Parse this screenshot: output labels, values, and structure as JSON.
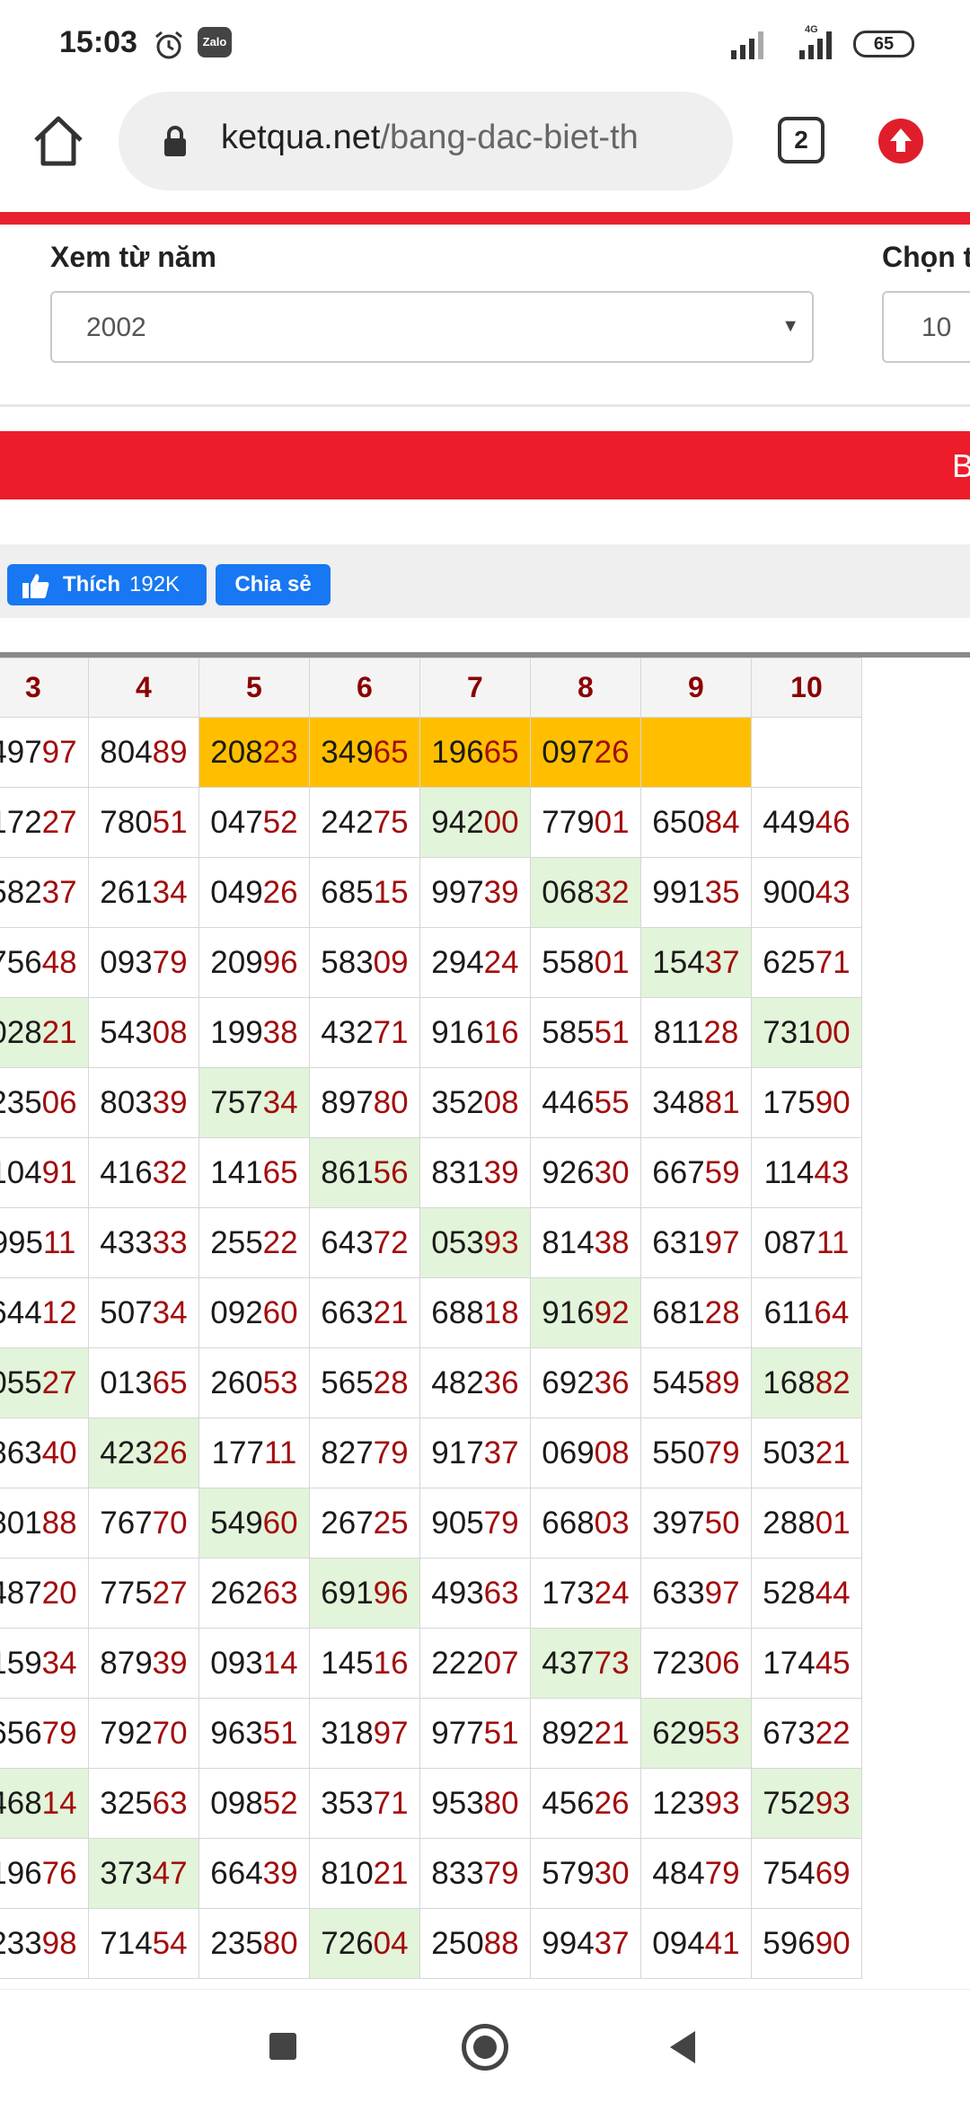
{
  "status_bar": {
    "time": "15:03",
    "zalo": "Zalo",
    "network": "4G",
    "battery": "65"
  },
  "browser": {
    "url_domain": "ketqua.net",
    "url_path": "/bang-dac-biet-th",
    "tab_count": "2"
  },
  "filters": {
    "from_year_label": "Xem từ năm",
    "from_year_value": "2002",
    "choose_label": "Chọn t",
    "choose_value": "10"
  },
  "banner_text": "B",
  "social": {
    "like_label": "Thích",
    "like_count": "192K",
    "share_label": "Chia sẻ"
  },
  "table": {
    "columns": [
      "",
      "3",
      "4",
      "5",
      "6",
      "7",
      "8",
      "9",
      "10"
    ],
    "rows": [
      [
        "",
        "49797",
        "80489",
        "20823",
        "34965",
        "19665",
        "09726",
        "",
        ""
      ],
      [
        "",
        "17227",
        "78051",
        "04752",
        "24275",
        "94200",
        "77901",
        "65084",
        "44946"
      ],
      [
        "",
        "58237",
        "26134",
        "04926",
        "68515",
        "99739",
        "06832",
        "99135",
        "90043"
      ],
      [
        "",
        "75648",
        "09379",
        "20996",
        "58309",
        "29424",
        "55801",
        "15437",
        "62571"
      ],
      [
        "",
        "02821",
        "54308",
        "19938",
        "43271",
        "91616",
        "58551",
        "81128",
        "73100"
      ],
      [
        "",
        "23506",
        "80339",
        "75734",
        "89780",
        "35208",
        "44655",
        "34881",
        "17590"
      ],
      [
        "",
        "10491",
        "41632",
        "14165",
        "86156",
        "83139",
        "92630",
        "66759",
        "11443"
      ],
      [
        "",
        "99511",
        "43333",
        "25522",
        "64372",
        "05393",
        "81438",
        "63197",
        "08711"
      ],
      [
        "",
        "64412",
        "50734",
        "09260",
        "66321",
        "68818",
        "91692",
        "68128",
        "61164"
      ],
      [
        "",
        "05527",
        "01365",
        "26053",
        "56528",
        "48236",
        "69236",
        "54589",
        "16882"
      ],
      [
        "",
        "86340",
        "42326",
        "17711",
        "82779",
        "91737",
        "06908",
        "55079",
        "50321"
      ],
      [
        "",
        "80188",
        "76770",
        "54960",
        "26725",
        "90579",
        "66803",
        "39750",
        "28801"
      ],
      [
        "",
        "48720",
        "77527",
        "26263",
        "69196",
        "49363",
        "17324",
        "63397",
        "52844"
      ],
      [
        "",
        "15934",
        "87939",
        "09314",
        "14516",
        "22207",
        "43773",
        "72306",
        "17445"
      ],
      [
        "",
        "65679",
        "79270",
        "96351",
        "31897",
        "97751",
        "89221",
        "62953",
        "67322"
      ],
      [
        "",
        "46814",
        "32563",
        "09852",
        "35371",
        "95380",
        "45626",
        "12393",
        "75293"
      ],
      [
        "",
        "19676",
        "37347",
        "66439",
        "81021",
        "83379",
        "57930",
        "48479",
        "75469"
      ],
      [
        "",
        "23398",
        "71454",
        "23580",
        "72604",
        "25088",
        "99437",
        "09441",
        "59690"
      ]
    ],
    "highlights": {
      "orange": [
        [
          0,
          2
        ],
        [
          0,
          3
        ],
        [
          0,
          4
        ],
        [
          0,
          5
        ],
        [
          0,
          6
        ]
      ],
      "green": [
        [
          1,
          4
        ],
        [
          2,
          5
        ],
        [
          3,
          6
        ],
        [
          4,
          0
        ],
        [
          4,
          7
        ],
        [
          5,
          2
        ],
        [
          6,
          3
        ],
        [
          7,
          4
        ],
        [
          8,
          5
        ],
        [
          9,
          0
        ],
        [
          9,
          7
        ],
        [
          10,
          1
        ],
        [
          10,
          8
        ],
        [
          11,
          2
        ],
        [
          12,
          3
        ],
        [
          13,
          5
        ],
        [
          14,
          6
        ],
        [
          15,
          0
        ],
        [
          15,
          7
        ],
        [
          16,
          1
        ],
        [
          16,
          8
        ],
        [
          17,
          3
        ]
      ]
    }
  },
  "colors": {
    "accent_red": "#e8212e",
    "highlight_orange": "#ffbf00",
    "highlight_green": "#e2f4d9",
    "number_tail": "#a30d0d",
    "facebook_blue": "#1877f2"
  },
  "icons": [
    "alarm-icon",
    "zalo-icon",
    "signal-icon",
    "battery-icon",
    "home-icon",
    "lock-icon",
    "tabs-icon",
    "update-icon",
    "thumbs-up-icon",
    "nav-recents-icon",
    "nav-home-icon",
    "nav-back-icon"
  ]
}
